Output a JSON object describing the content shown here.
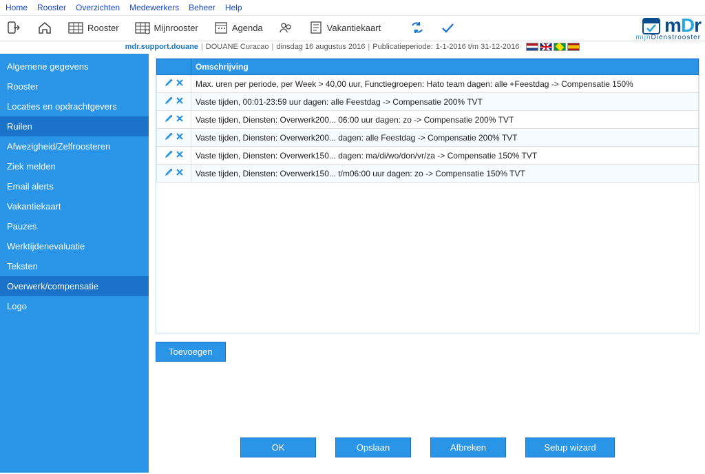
{
  "topmenu": [
    "Home",
    "Rooster",
    "Overzichten",
    "Medewerkers",
    "Beheer",
    "Help"
  ],
  "toolbar": {
    "logout": "",
    "home": "",
    "rooster": "Rooster",
    "mijnrooster": "Mijnrooster",
    "agenda": "Agenda",
    "team": "",
    "vakantiekaart": "Vakantiekaart"
  },
  "logo": {
    "brand_m": "m",
    "brand_d": "D",
    "brand_r": "r",
    "sub_a": "mijn",
    "sub_b": "Dienstrooster"
  },
  "status": {
    "user": "mdr.support.douane",
    "org": "DOUANE Curacao",
    "date": "dinsdag 16 augustus 2016",
    "pubperiod_label": "Publicatieperiode:",
    "pubperiod": "1-1-2016 t/m 31-12-2016"
  },
  "sidebar": [
    {
      "label": "Algemene gegevens",
      "sel": false
    },
    {
      "label": "Rooster",
      "sel": false
    },
    {
      "label": "Locaties en opdrachtgevers",
      "sel": false
    },
    {
      "label": "Ruilen",
      "sel": true
    },
    {
      "label": "Afwezigheid/Zelfroosteren",
      "sel": false
    },
    {
      "label": "Ziek melden",
      "sel": false
    },
    {
      "label": "Email alerts",
      "sel": false
    },
    {
      "label": "Vakantiekaart",
      "sel": false
    },
    {
      "label": "Pauzes",
      "sel": false
    },
    {
      "label": "Werktijdenevaluatie",
      "sel": false
    },
    {
      "label": "Teksten",
      "sel": false
    },
    {
      "label": "Overwerk/compensatie",
      "sel": true
    },
    {
      "label": "Logo",
      "sel": false
    }
  ],
  "table": {
    "header": "Omschrijving",
    "rows": [
      "Max. uren per periode, per Week > 40,00 uur, Functiegroepen: Hato team dagen: alle +Feestdag -> Compensatie 150%",
      "Vaste tijden, 00:01-23:59 uur dagen: alle Feestdag -> Compensatie 200% TVT",
      "Vaste tijden, Diensten: Overwerk200... 06:00 uur dagen: zo -> Compensatie 200% TVT",
      "Vaste tijden, Diensten: Overwerk200... dagen: alle Feestdag -> Compensatie 200% TVT",
      "Vaste tijden, Diensten: Overwerk150... dagen: ma/di/wo/don/vr/za -> Compensatie 150% TVT",
      "Vaste tijden, Diensten: Overwerk150... t/m06:00 uur dagen: zo -> Compensatie 150% TVT"
    ]
  },
  "buttons": {
    "add": "Toevoegen",
    "ok": "OK",
    "save": "Opslaan",
    "cancel": "Afbreken",
    "wizard": "Setup wizard"
  }
}
